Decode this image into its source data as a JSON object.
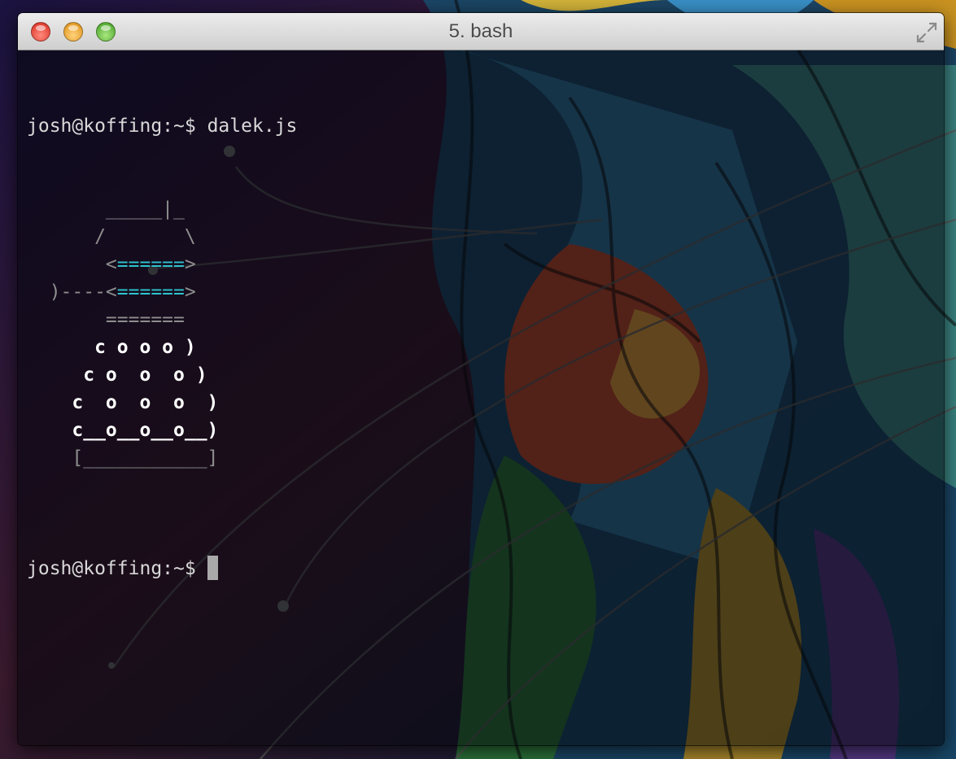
{
  "window": {
    "title": "5. bash"
  },
  "terminal": {
    "prompt": "josh@koffing:~$",
    "command": "dalek.js",
    "ascii_art": [
      {
        "cls": "grey",
        "text": "       _____|_"
      },
      {
        "cls": "grey",
        "text": "      /       \\"
      },
      {
        "segments": [
          {
            "cls": "grey",
            "text": "       <"
          },
          {
            "cls": "cyan",
            "text": "======"
          },
          {
            "cls": "grey",
            "text": ">"
          }
        ]
      },
      {
        "segments": [
          {
            "cls": "grey",
            "text": "  )----<"
          },
          {
            "cls": "cyan",
            "text": "======"
          },
          {
            "cls": "grey",
            "text": ">"
          }
        ]
      },
      {
        "cls": "grey",
        "text": "       ======="
      },
      {
        "cls": "white",
        "text": "      c o o o )"
      },
      {
        "cls": "white",
        "text": "     c o  o  o )"
      },
      {
        "cls": "white",
        "text": "    c  o  o  o  )"
      },
      {
        "cls": "white",
        "text": "    c__o__o__o__)"
      },
      {
        "cls": "grey",
        "text": "    [___________]"
      },
      {
        "cls": "grey",
        "text": ""
      }
    ]
  },
  "colors": {
    "ascii_grey": "#8e8e8e",
    "ascii_cyan": "#2ec4cf",
    "ascii_white": "#ffffff",
    "text": "#d8d8d8"
  },
  "icons": {
    "close": "close-traffic-light-icon",
    "minimize": "minimize-traffic-light-icon",
    "zoom": "zoom-traffic-light-icon",
    "fullscreen": "fullscreen-arrows-icon"
  }
}
